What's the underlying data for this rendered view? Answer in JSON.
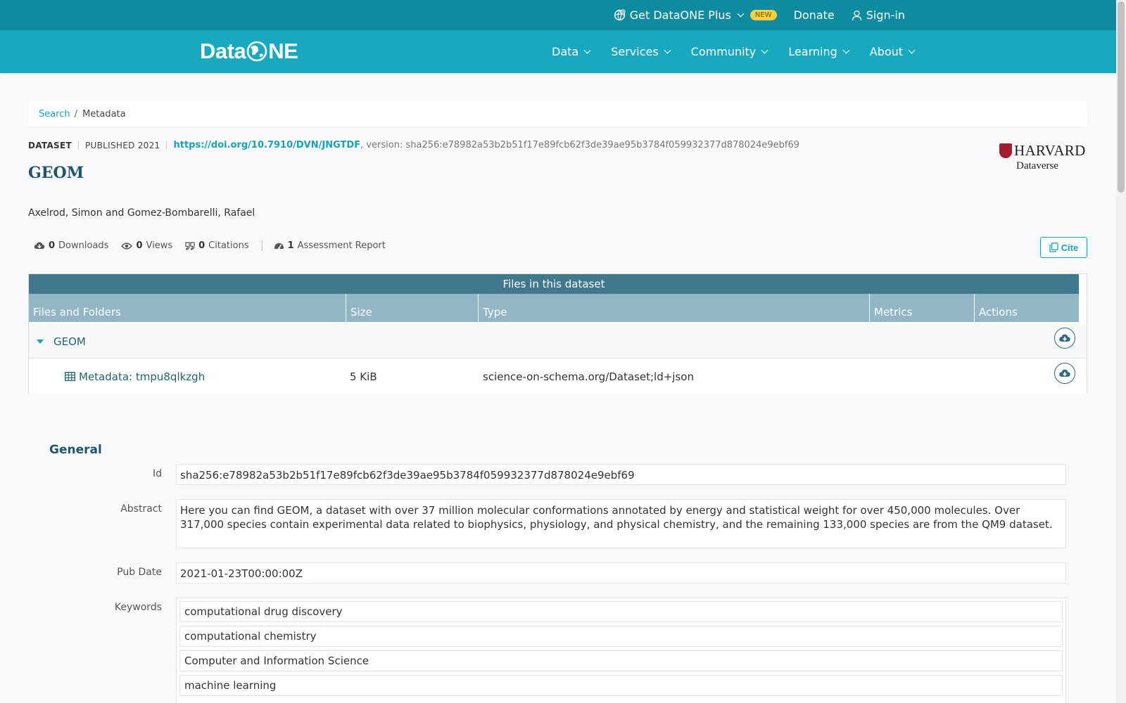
{
  "topbar": {
    "plus_label": "Get DataONE Plus",
    "new_badge": "NEW",
    "donate_label": "Donate",
    "signin_label": "Sign-in"
  },
  "nav": {
    "logo_left": "Data",
    "logo_right": "NE",
    "items": [
      "Data",
      "Services",
      "Community",
      "Learning",
      "About"
    ]
  },
  "breadcrumb": {
    "search": "Search",
    "separator": "/",
    "current": "Metadata"
  },
  "dataset": {
    "type": "DATASET",
    "published": "PUBLISHED 2021",
    "doi": "https://doi.org/10.7910/DVN/JNGTDF",
    "version_text": ", version: sha256:e78982a53b2b51f17e89fcb62f3de39ae95b3784f059932377d878024e9ebf69",
    "title": "GEOM",
    "authors": "Axelrod, Simon and Gomez-Bombarelli, Rafael"
  },
  "repository_logo": {
    "name": "HARVARD",
    "sub": "Dataverse"
  },
  "metrics": {
    "downloads_count": "0",
    "downloads_label": "Downloads",
    "views_count": "0",
    "views_label": "Views",
    "citations_count": "0",
    "citations_label": "Citations",
    "assessment_count": "1",
    "assessment_label": "Assessment Report"
  },
  "cite_label": "Cite",
  "files_table": {
    "caption": "Files in this dataset",
    "headers": [
      "Files and Folders",
      "Size",
      "Type",
      "Metrics",
      "Actions"
    ],
    "folder": {
      "name": "GEOM"
    },
    "files": [
      {
        "name": "Metadata: tmpu8qlkzgh",
        "size": "5 KiB",
        "type": "science-on-schema.org/Dataset;ld+json"
      }
    ]
  },
  "general": {
    "title": "General",
    "id_label": "Id",
    "id_value": "sha256:e78982a53b2b51f17e89fcb62f3de39ae95b3784f059932377d878024e9ebf69",
    "abstract_label": "Abstract",
    "abstract_value": "Here you can find GEOM, a dataset with over 37 million molecular conformations annotated by energy and statistical weight for over 450,000 molecules. Over 317,000 species contain experimental data related to biophysics, physiology, and physical chemistry, and the remaining 133,000 species are from the QM9 dataset.",
    "pubdate_label": "Pub Date",
    "pubdate_value": "2021-01-23T00:00:00Z",
    "keywords_label": "Keywords",
    "keywords": [
      "computational drug discovery",
      "computational chemistry",
      "Computer and Information Science",
      "machine learning"
    ]
  },
  "colors": {
    "topbar": "#0f8ba0",
    "nav": "#18a8bf",
    "accent": "#17a2b8",
    "table_caption": "#41788e",
    "table_header": "#93b6c5",
    "harvard_red": "#a51c30"
  },
  "icons": [
    "globe-plus-icon",
    "chevron-down-icon",
    "user-icon",
    "cloud-download-icon",
    "eye-icon",
    "quote-icon",
    "gauge-icon",
    "copy-icon",
    "caret-down-icon",
    "table-icon",
    "download-circle-icon"
  ]
}
